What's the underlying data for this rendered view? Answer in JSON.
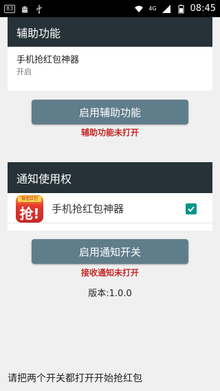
{
  "status_bar": {
    "notification_badge": "83",
    "network_label": "4G",
    "time": "08:45",
    "icons": [
      "notification-count-icon",
      "android-icon",
      "usb-icon",
      "wifi-icon",
      "signal-icon",
      "battery-icon"
    ]
  },
  "accessibility": {
    "header": "辅助功能",
    "item_title": "手机抢红包神器",
    "item_status": "开启",
    "button_label": "启用辅助功能",
    "warning": "辅助功能未打开"
  },
  "notification_access": {
    "header": "通知使用权",
    "app_icon_tag": "微信红包",
    "app_icon_glyph": "抢!",
    "app_name": "手机抢红包神器",
    "checked": true,
    "button_label": "启用通知开关",
    "warning": "接收通知未打开"
  },
  "version": "版本:1.0.0",
  "bottom_tip": "请把两个开关都打开开始抢红包",
  "colors": {
    "header_bg": "#263238",
    "button_bg": "#607d8b",
    "warning_text": "#c62828",
    "checkbox": "#009688",
    "page_bg": "#f0f0f0"
  }
}
